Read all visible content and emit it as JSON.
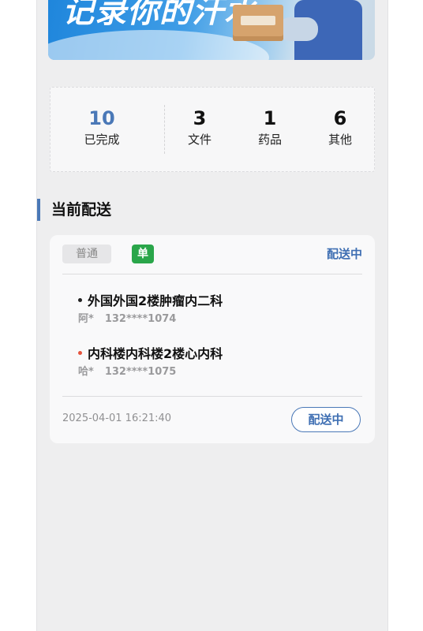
{
  "banner": {
    "slogan": "记录你的汗水",
    "box_text": "",
    "accent_color": "#1f86dc"
  },
  "stats": [
    {
      "value": "10",
      "label": "已完成",
      "highlight": true
    },
    {
      "value": "3",
      "label": "文件",
      "highlight": false
    },
    {
      "value": "1",
      "label": "药品",
      "highlight": false
    },
    {
      "value": "6",
      "label": "其他",
      "highlight": false
    }
  ],
  "section": {
    "title": "当前配送"
  },
  "delivery": {
    "tag_normal": "普通",
    "tag_single": "单",
    "status": "配送中",
    "stops": [
      {
        "address": "外国外国2楼肿瘤内二科",
        "name": "阿*",
        "phone": "132****1074",
        "dot_color": "#222222"
      },
      {
        "address": "内科楼内科楼2楼心内科",
        "name": "哈*",
        "phone": "132****1075",
        "dot_color": "#e5533d"
      }
    ],
    "time": "2025-04-01 16:21:40",
    "button_label": "配送中"
  },
  "colors": {
    "primary": "#4a78b7",
    "tag_green": "#2aa64a",
    "background": "#eeeeef"
  }
}
